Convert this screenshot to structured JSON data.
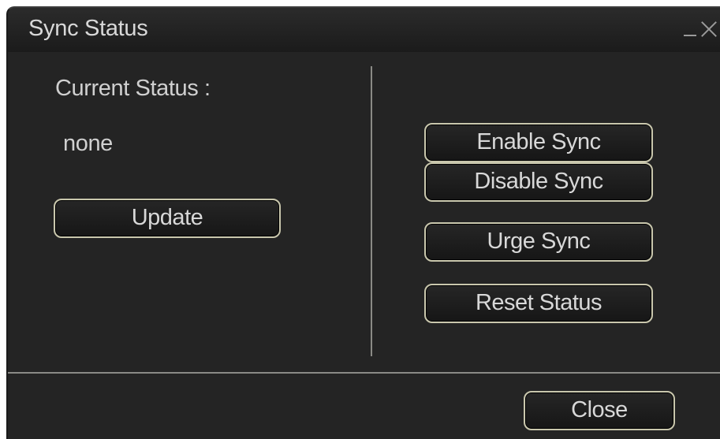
{
  "window": {
    "title": "Sync Status",
    "minimize_icon": "minimize-icon",
    "close_icon": "close-icon"
  },
  "status": {
    "label": "Current Status :",
    "value": "none"
  },
  "buttons": {
    "update": "Update",
    "enable_sync": "Enable Sync",
    "disable_sync": "Disable Sync",
    "urge_sync": "Urge Sync",
    "reset_status": "Reset Status",
    "close": "Close"
  },
  "colors": {
    "background": "#242424",
    "button_border": "#c9c7ad",
    "text": "#d8d8d8"
  }
}
